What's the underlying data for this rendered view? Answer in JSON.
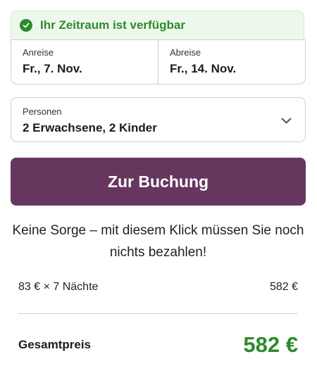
{
  "availability": {
    "text": "Ihr Zeitraum ist verfügbar"
  },
  "dates": {
    "arrival_label": "Anreise",
    "arrival_value": "Fr., 7. Nov.",
    "departure_label": "Abreise",
    "departure_value": "Fr., 14. Nov."
  },
  "persons": {
    "label": "Personen",
    "value": "2 Erwachsene, 2 Kinder"
  },
  "book_button": {
    "label": "Zur Buchung"
  },
  "note": "Keine Sorge – mit diesem Klick müssen Sie noch nichts bezahlen!",
  "price": {
    "nights_label": "83 € × 7 Nächte",
    "nights_value": "582 €",
    "total_label": "Gesamtpreis",
    "total_value": "582 €"
  },
  "colors": {
    "success": "#2e8b2b",
    "brand": "#66365f",
    "border": "#cfcfcf"
  },
  "icons": {
    "availability": "check-circle-icon",
    "persons_dropdown": "chevron-down-icon"
  }
}
